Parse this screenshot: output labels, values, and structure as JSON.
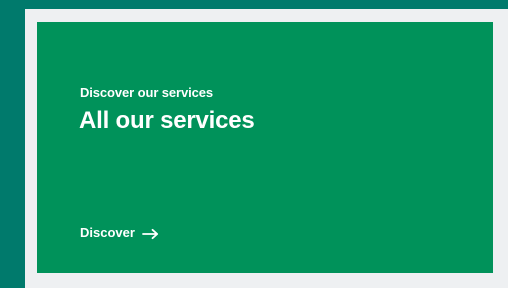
{
  "card": {
    "eyebrow": "Discover our services",
    "title": "All our services",
    "link_label": "Discover",
    "link_icon": "arrow-right-icon"
  },
  "colors": {
    "outer_background": "#007a6c",
    "panel_background": "#eef0f2",
    "card_background": "#00925a",
    "text": "#ffffff"
  }
}
